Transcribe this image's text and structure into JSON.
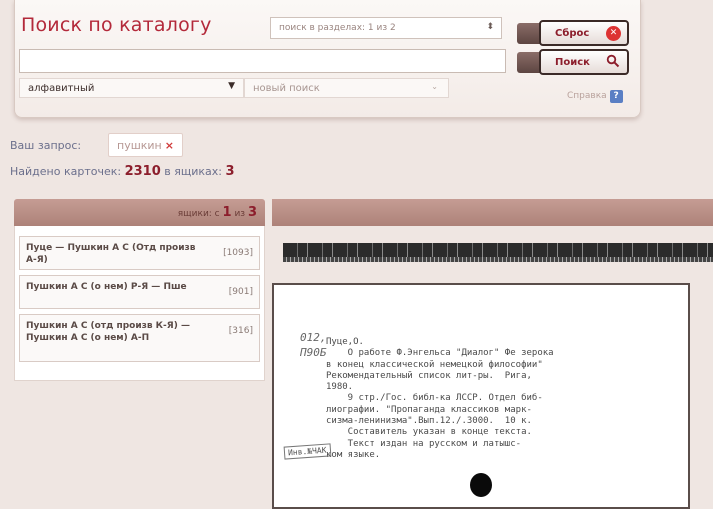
{
  "panel": {
    "title": "Поиск по каталогу",
    "scope_select": "поиск в разделах: 1 из 2",
    "scope_arrow": "⬍",
    "query_value": "",
    "mode_select": "алфавитный",
    "mode_arrow": "▼",
    "new_search_select": "новый поиск",
    "new_search_arrow": "⌄",
    "reset_label": "Сброс",
    "search_label": "Поиск",
    "help_label": "Справка",
    "help_icon": "?"
  },
  "query": {
    "label": "Ваш запрос:",
    "term": "пушкин",
    "remove": "×"
  },
  "found": {
    "prefix": "Найдено карточек:",
    "cards": "2310",
    "middle": "в ящиках:",
    "boxes": "3"
  },
  "left": {
    "header_prefix": "ящики: с",
    "from": "1",
    "of": "из",
    "total": "3",
    "boxes": [
      {
        "title": "Пуце — Пушкин А С (Отд произв А-Я)",
        "count": "[1093]"
      },
      {
        "title": "Пушкин А С (о нем) Р-Я — Пше",
        "count": "[901]"
      },
      {
        "title": "Пушкин А С (отд произв К-Я) — Пушкин А С (о нем) А-П",
        "count": "[316]"
      }
    ]
  },
  "card": {
    "number": "012,",
    "shelf": "П90Б",
    "text": "Пуце,О.\n    О работе Ф.Энгельса \"Диалог\" Фе зерока\nв конец классической немецкой философии\"\nРекомендательный список лит-ры.  Рига,\n1980.\n    9 стр./Гос. библ-ка ЛССР. Отдел биб-\nлиографии. \"Пропаганда классиков марк-\nсизма-ленинизма\".Вып.12./.3000.  10 к.\n    Составитель указан в конце текста.\n    Текст издан на русском и латышс-\nком языке.",
    "stamp": "Инв.№ЧАК"
  }
}
